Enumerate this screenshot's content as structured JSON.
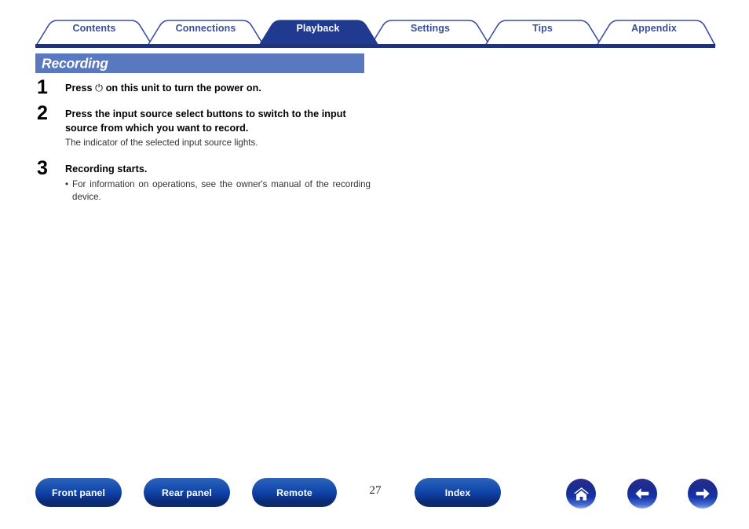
{
  "tabs": [
    {
      "label": "Contents",
      "active": false
    },
    {
      "label": "Connections",
      "active": false
    },
    {
      "label": "Playback",
      "active": true
    },
    {
      "label": "Settings",
      "active": false
    },
    {
      "label": "Tips",
      "active": false
    },
    {
      "label": "Appendix",
      "active": false
    }
  ],
  "heading": {
    "title": "Recording"
  },
  "steps": [
    {
      "number": "1",
      "title_before": "Press ",
      "power_icon": "⏻",
      "title_after": " on this unit to turn the power on."
    },
    {
      "number": "2",
      "title": "Press the input source select buttons to switch to the input source from which you want to record.",
      "sub": "The indicator of the selected input source lights."
    },
    {
      "number": "3",
      "title": "Recording starts.",
      "bullet_dot": "•",
      "bullet": "For information on operations, see the owner's manual of the recording device."
    }
  ],
  "footer": {
    "front_panel": "Front panel",
    "rear_panel": "Rear panel",
    "remote": "Remote",
    "index": "Index",
    "page_number": "27",
    "home_icon": "home-icon",
    "back_icon": "arrow-left-icon",
    "next_icon": "arrow-right-icon"
  },
  "colors": {
    "tab_active_bg": "#203a8f",
    "tab_outline": "#3a4ea0",
    "tab_baseline": "#1f3476",
    "heading_bg": "#5a78c0",
    "button_blue": "#0f42a8"
  }
}
